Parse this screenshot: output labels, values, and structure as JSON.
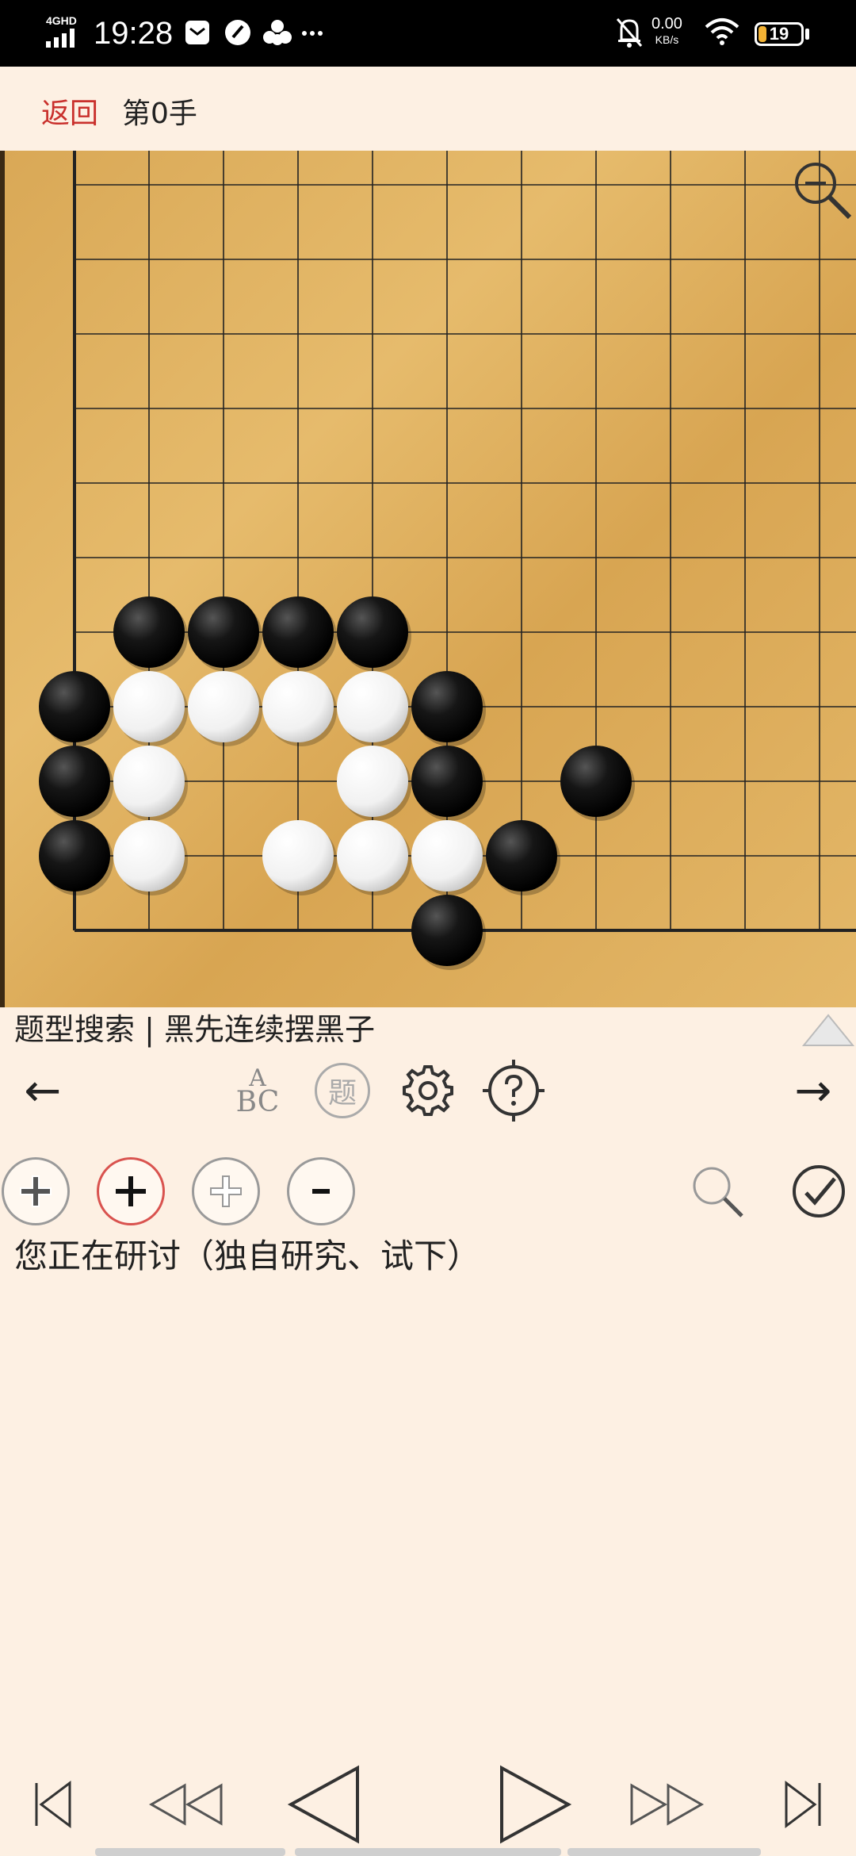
{
  "status_bar": {
    "network": "4GHD",
    "time": "19:28",
    "speed_value": "0.00",
    "speed_unit": "KB/s",
    "battery": "19",
    "battery_level": 0.19
  },
  "header": {
    "back_label": "返回",
    "move_label": "第0手"
  },
  "board": {
    "size": 19,
    "visible_corner": "bottom-left",
    "star_points": [
      [
        3,
        15
      ],
      [
        9,
        15
      ],
      [
        15,
        15
      ]
    ],
    "black_stones": [
      [
        2,
        5
      ],
      [
        3,
        5
      ],
      [
        4,
        5
      ],
      [
        5,
        5
      ],
      [
        1,
        4
      ],
      [
        6,
        4
      ],
      [
        1,
        3
      ],
      [
        6,
        3
      ],
      [
        8,
        3
      ],
      [
        1,
        2
      ],
      [
        7,
        2
      ],
      [
        6,
        1
      ]
    ],
    "white_stones": [
      [
        2,
        4
      ],
      [
        3,
        4
      ],
      [
        4,
        4
      ],
      [
        5,
        4
      ],
      [
        2,
        3
      ],
      [
        5,
        3
      ],
      [
        2,
        2
      ],
      [
        4,
        2
      ],
      [
        5,
        2
      ],
      [
        6,
        2
      ]
    ]
  },
  "problem": {
    "title": "题型搜索 | 黑先连续摆黑子"
  },
  "toolbar": {
    "prev_arrow": "←",
    "next_arrow": "→",
    "abc_top": "A",
    "abc_bottom": "BC",
    "ti_label": "题",
    "icons": [
      "abc-icon",
      "ti-icon",
      "gear-icon",
      "help-crosshair-icon"
    ]
  },
  "edit_tools": {
    "status_message": "您正在研讨（独自研究、试下）",
    "icons": [
      "add-black-icon",
      "add-icon",
      "add-white-icon",
      "remove-icon",
      "search-icon",
      "confirm-icon"
    ]
  },
  "nav": {
    "icons": [
      "first-icon",
      "fast-back-icon",
      "back-icon",
      "forward-icon",
      "fast-forward-icon",
      "last-icon"
    ]
  }
}
